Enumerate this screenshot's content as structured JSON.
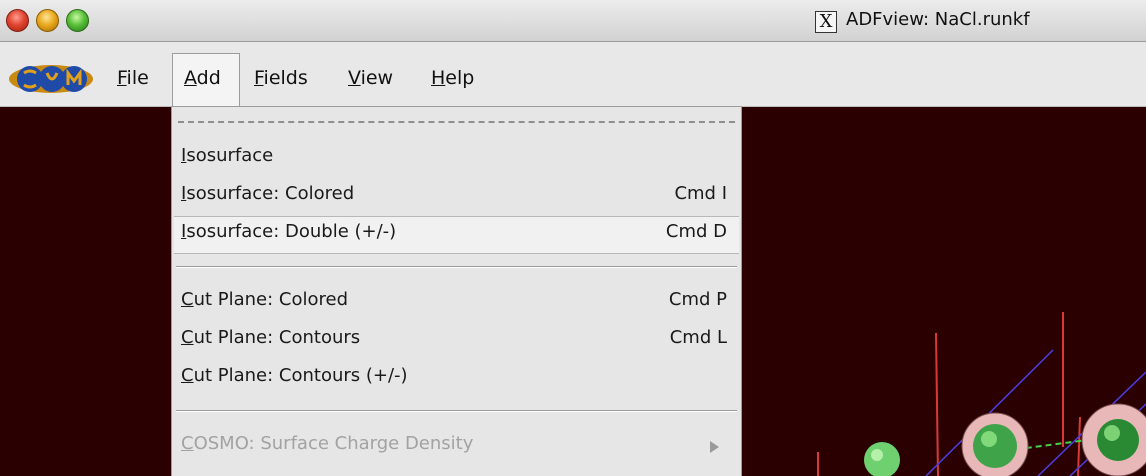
{
  "window": {
    "title": "ADFview: NaCl.runkf"
  },
  "menubar": {
    "file": "File",
    "add": "Add",
    "fields": "Fields",
    "view": "View",
    "help": "Help"
  },
  "add_menu": {
    "items": [
      {
        "label": "Isosurface",
        "shortcut": ""
      },
      {
        "label": "Isosurface: Colored",
        "shortcut": "Cmd I"
      },
      {
        "label": "Isosurface: Double (+/-)",
        "shortcut": "Cmd D"
      },
      {
        "label": "Cut Plane: Colored",
        "shortcut": "Cmd P"
      },
      {
        "label": "Cut Plane: Contours",
        "shortcut": "Cmd L"
      },
      {
        "label": "Cut Plane: Contours (+/-)",
        "shortcut": ""
      },
      {
        "label": "COSMO: Surface Charge Density",
        "shortcut": ""
      }
    ]
  },
  "colors": {
    "viewport_bg": "#2a0000",
    "menu_bg": "#e6e6e6",
    "highlight_bg": "#f1f1f1",
    "disabled_text": "#a2a2a2"
  },
  "icons": [
    "close-button",
    "minimize-button",
    "zoom-button",
    "x11-icon",
    "scm-logo",
    "submenu-arrow-icon"
  ]
}
